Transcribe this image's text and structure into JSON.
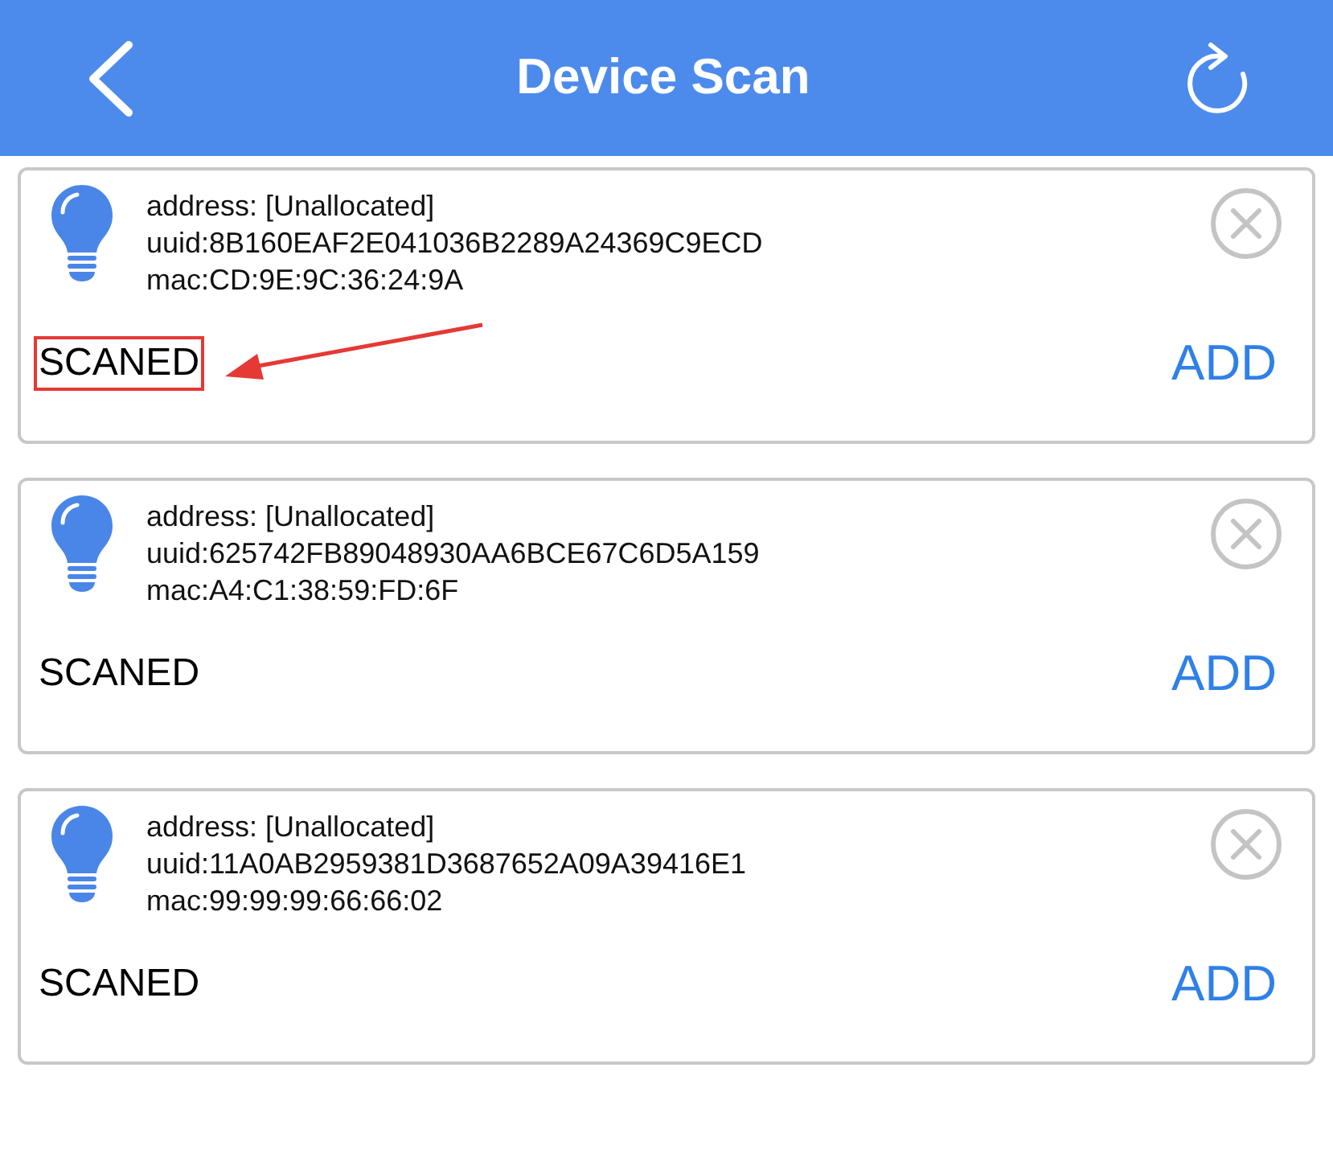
{
  "header": {
    "title": "Device Scan"
  },
  "devices": [
    {
      "address": "address: [Unallocated]",
      "uuid": "uuid:8B160EAF2E041036B2289A24369C9ECD",
      "mac": "mac:CD:9E:9C:36:24:9A",
      "status": "SCANED",
      "action": "ADD",
      "highlighted": true
    },
    {
      "address": "address: [Unallocated]",
      "uuid": "uuid:625742FB89048930AA6BCE67C6D5A159",
      "mac": "mac:A4:C1:38:59:FD:6F",
      "status": "SCANED",
      "action": "ADD",
      "highlighted": false
    },
    {
      "address": "address: [Unallocated]",
      "uuid": "uuid:11A0AB2959381D3687652A09A39416E1",
      "mac": "mac:99:99:99:66:66:02",
      "status": "SCANED",
      "action": "ADD",
      "highlighted": false
    }
  ]
}
